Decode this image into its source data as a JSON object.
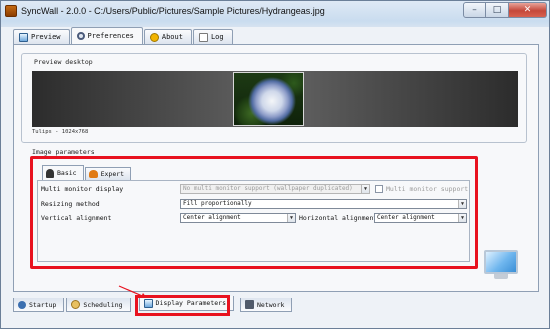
{
  "window": {
    "title": "SyncWall - 2.0.0 - C:/Users/Public/Pictures/Sample Pictures/Hydrangeas.jpg",
    "minimize": "–",
    "maximize": "□",
    "close": "✕"
  },
  "top_tabs": [
    {
      "label": "Preview",
      "icon": "monitor-icon"
    },
    {
      "label": "Preferences",
      "icon": "gear-icon",
      "active": true
    },
    {
      "label": "About",
      "icon": "info-icon"
    },
    {
      "label": "Log",
      "icon": "log-icon"
    }
  ],
  "preview": {
    "group_label": "Preview  desktop",
    "caption": "Tulips - 1024x768"
  },
  "image_parameters": {
    "group_label": "Image parameters",
    "tabs": [
      {
        "label": "Basic",
        "icon": "person-icon",
        "active": true
      },
      {
        "label": "Expert",
        "icon": "fox-icon"
      }
    ],
    "multi_monitor": {
      "label": "Multi monitor display",
      "value": "No multi monitor support (wallpaper duplicated)",
      "checkbox_label": "Multi monitor support"
    },
    "resizing": {
      "label": "Resizing method",
      "value": "Fill proportionally"
    },
    "vertical": {
      "label": "Vertical alignment",
      "value": "Center alignment"
    },
    "horizontal": {
      "label": "Horizontal alignment",
      "value": "Center alignment"
    }
  },
  "bottom_tabs": [
    {
      "label": "Startup",
      "icon": "tool-icon"
    },
    {
      "label": "Scheduling",
      "icon": "clock-icon"
    },
    {
      "label": "Display Parameters",
      "icon": "monitor-icon",
      "active": true
    },
    {
      "label": "Network",
      "icon": "network-icon"
    }
  ],
  "colors": {
    "highlight": "#e8121f",
    "panel": "#f7f8fa"
  }
}
